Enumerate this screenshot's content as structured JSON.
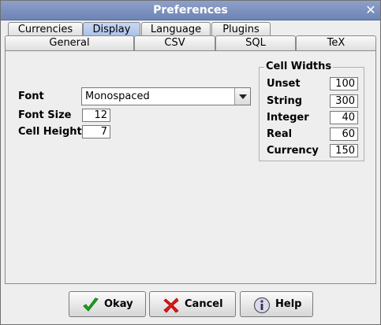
{
  "window": {
    "title": "Preferences",
    "close_glyph": "✕"
  },
  "tabs_row1": [
    {
      "label": "Currencies",
      "selected": false
    },
    {
      "label": "Display",
      "selected": true
    },
    {
      "label": "Language",
      "selected": false
    },
    {
      "label": "Plugins",
      "selected": false
    }
  ],
  "tabs_row2": [
    {
      "label": "General"
    },
    {
      "label": "CSV"
    },
    {
      "label": "SQL"
    },
    {
      "label": "TeX"
    }
  ],
  "display": {
    "font_label": "Font",
    "font_value": "Monospaced",
    "font_size_label": "Font Size",
    "font_size_value": "12",
    "cell_height_label": "Cell Height",
    "cell_height_value": "7"
  },
  "cell_widths": {
    "title": "Cell Widths",
    "rows": [
      {
        "label": "Unset",
        "value": "100"
      },
      {
        "label": "String",
        "value": "300"
      },
      {
        "label": "Integer",
        "value": "40"
      },
      {
        "label": "Real",
        "value": "60"
      },
      {
        "label": "Currency",
        "value": "150"
      }
    ]
  },
  "buttons": {
    "okay": "Okay",
    "cancel": "Cancel",
    "help": "Help"
  },
  "icons": {
    "okay": "checkmark-icon",
    "cancel": "x-icon",
    "help": "info-icon"
  },
  "colors": {
    "selected_tab": "#b5c9ea",
    "titlebar": "#7b8fbe",
    "okay_icon": "#1ea51e",
    "cancel_icon": "#e01818"
  }
}
